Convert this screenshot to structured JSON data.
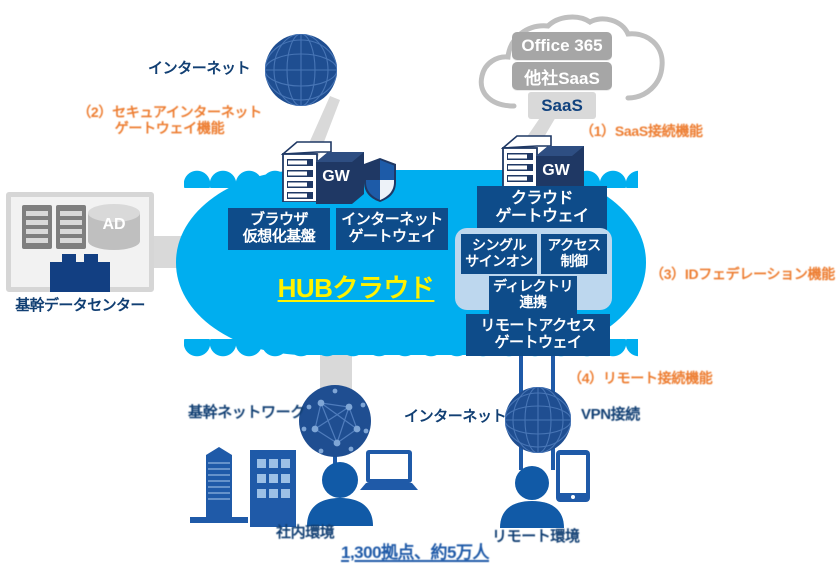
{
  "diagram": {
    "hub": {
      "title": "HUBクラウド",
      "title_color": "#FFF200",
      "body_color": "#00AEEF",
      "services": [
        {
          "id": "browser-virtualization",
          "label": "ブラウザ\n仮想化基盤"
        },
        {
          "id": "internet-gateway",
          "label": "インターネット\nゲートウェイ"
        },
        {
          "id": "cloud-gateway",
          "label": "クラウド\nゲートウェイ"
        },
        {
          "id": "single-sign-on",
          "label": "シングル\nサインオン"
        },
        {
          "id": "access-control",
          "label": "アクセス\n制御"
        },
        {
          "id": "directory-federation",
          "label": "ディレクトリ\n連携"
        },
        {
          "id": "remote-access-gateway",
          "label": "リモートアクセス\nゲートウェイ"
        }
      ],
      "gw_badge_left": "GW",
      "gw_badge_right": "GW"
    },
    "saas_cloud": {
      "items": [
        {
          "id": "office365",
          "label": "Office 365"
        },
        {
          "id": "other-saas",
          "label": "他社SaaS"
        }
      ],
      "tab_label": "SaaS"
    },
    "datacenter": {
      "caption": "基幹データセンター",
      "ad_label": "AD"
    },
    "features": [
      {
        "id": "f1",
        "label": "（1）SaaS接続機能",
        "color": "#ED7D31"
      },
      {
        "id": "f2",
        "label": "（2）セキュアインターネット\nゲートウェイ機能",
        "color": "#ED7D31"
      },
      {
        "id": "f3",
        "label": "（3）IDフェデレーション機能",
        "color": "#ED7D31"
      },
      {
        "id": "f4",
        "label": "（4）リモート接続機能",
        "color": "#ED7D31"
      }
    ],
    "labels": {
      "internet_top": "インターネット",
      "internet_bottom": "インターネット",
      "core_network": "基幹ネットワーク",
      "vpn_connection": "VPN接続",
      "office_env": "社内環境",
      "remote_env": "リモート環境",
      "scale_note": "1,300拠点、約5万人"
    }
  }
}
